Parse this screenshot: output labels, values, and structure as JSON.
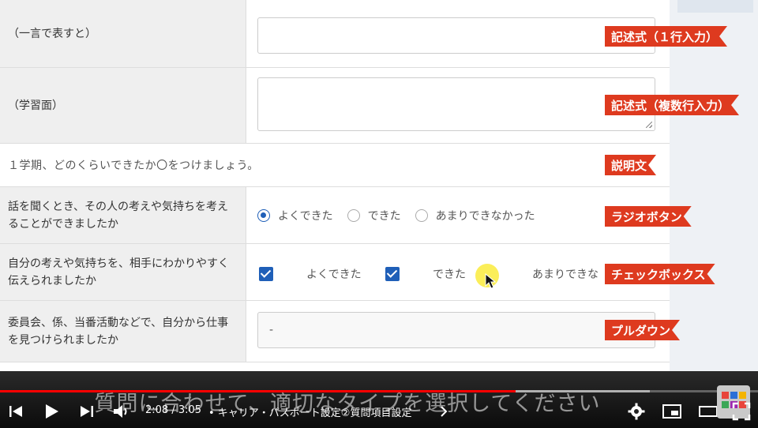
{
  "form": {
    "rows": [
      {
        "label": "（一言で表すと）",
        "type": "text"
      },
      {
        "label": "（学習面）",
        "type": "textarea"
      },
      {
        "text": "１学期、どのくらいできたか〇をつけましょう。",
        "type": "description"
      },
      {
        "label": "話を聞くとき、その人の考えや気持ちを考えることができましたか",
        "type": "radio",
        "options": [
          "よくできた",
          "できた",
          "あまりできなかった"
        ],
        "selected": "よくできた"
      },
      {
        "label": "自分の考えや気持ちを、相手にわかりやすく伝えられましたか",
        "type": "checkbox",
        "options": [
          "よくできた",
          "できた",
          "あまりできな"
        ],
        "checked": [
          "よくできた",
          "できた"
        ]
      },
      {
        "label": "委員会、係、当番活動などで、自分から仕事を見つけられましたか",
        "type": "select",
        "value": "-"
      }
    ]
  },
  "annotations": [
    "記述式（１行入力）",
    "記述式（複数行入力）",
    "説明文",
    "ラジオボタン",
    "チェックボックス",
    "プルダウン"
  ],
  "player": {
    "subtitle": "質問に合わせて、適切なタイプを選択してください",
    "time": "2:08 / 3:05",
    "chapter": "• キャリア・パスポート設定②質問項目設定",
    "progress": 0.68,
    "icons": [
      "prev-icon",
      "play-icon",
      "next-icon",
      "volume-icon",
      "chevron-right-icon",
      "settings-icon",
      "miniplayer-icon",
      "theater-icon",
      "fullscreen-icon"
    ]
  },
  "colors": {
    "accent": "#1f5fb8",
    "tag": "#de3a1f",
    "progress": "#ff0000"
  }
}
